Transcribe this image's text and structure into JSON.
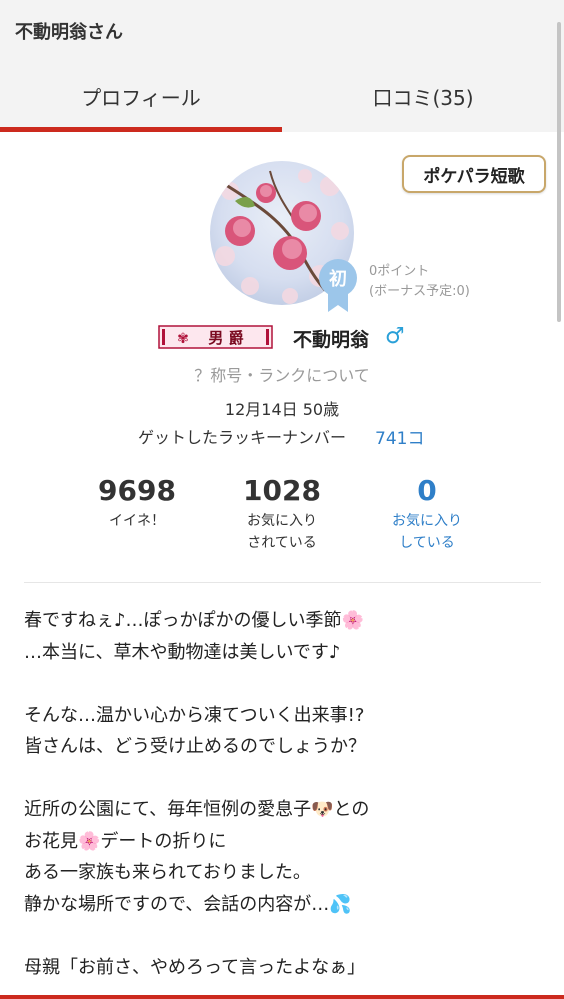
{
  "header": {
    "title": "不動明翁さん"
  },
  "tabs": [
    {
      "label": "プロフィール",
      "active": true
    },
    {
      "label": "口コミ(35)",
      "active": false
    }
  ],
  "profile": {
    "tanka_button": "ポケパラ短歌",
    "badge_char": "初",
    "points": "0ポイント",
    "bonus": "(ボーナス予定:0)",
    "title_rank": "男 爵",
    "username": "不動明翁",
    "gender_symbol": "♂",
    "rank_link": "？称号・ランクについて",
    "birth_age": "12月14日 50歳",
    "lucky_label": "ゲットしたラッキーナンバー",
    "lucky_value": "741コ"
  },
  "stats": [
    {
      "value": "9698",
      "label_line1": "イイネ！",
      "label_line2": ""
    },
    {
      "value": "1028",
      "label_line1": "お気に入り",
      "label_line2": "されている"
    },
    {
      "value": "0",
      "label_line1": "お気に入り",
      "label_line2": "している"
    }
  ],
  "post": {
    "lines": [
      "春ですねぇ♪…ぽっかぽかの優しい季節🌸",
      "…本当に、草木や動物達は美しいです♪",
      "",
      "そんな…温かい心から凍てついく出来事!?",
      "皆さんは、どう受け止めるのでしょうか？",
      "",
      "近所の公園にて、毎年恒例の愛息子🐶との",
      "お花見🌸デートの折りに",
      "ある一家族も来られておりました。",
      "静かな場所ですので、会話の内容が…💦",
      "",
      "母親「お前さ、やめろって言ったよなぁ」"
    ]
  },
  "colors": {
    "accent": "#cc2a1e",
    "link": "#2f7fc8",
    "gender": "#2aa0d8",
    "button_border": "#c8a76a"
  }
}
